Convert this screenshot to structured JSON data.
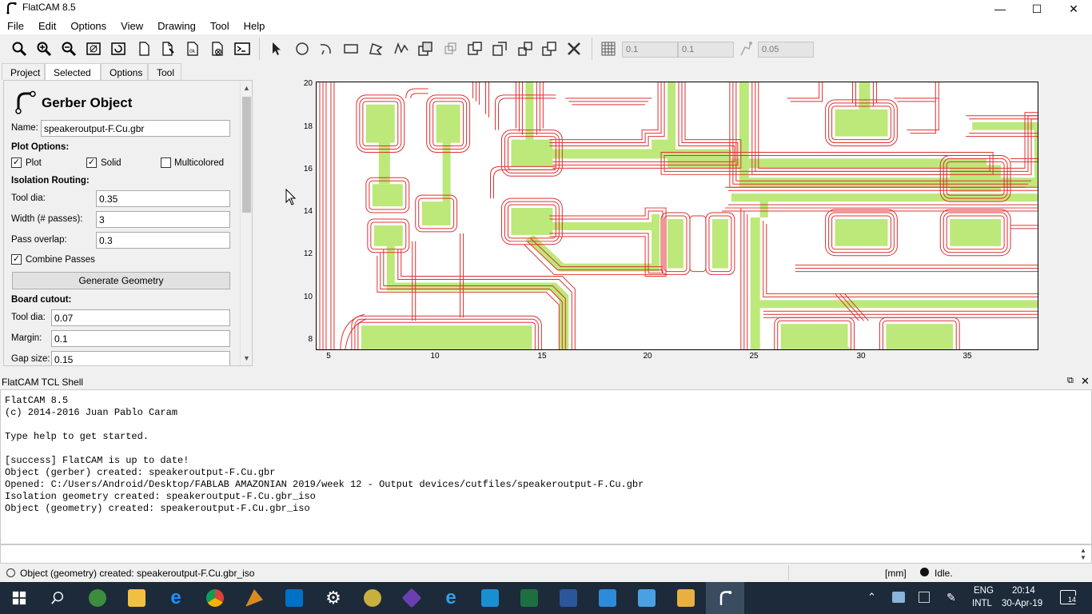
{
  "window": {
    "title": "FlatCAM 8.5",
    "minimize": "—",
    "maximize": "☐",
    "close": "✕"
  },
  "menu": [
    "File",
    "Edit",
    "Options",
    "View",
    "Drawing",
    "Tool",
    "Help"
  ],
  "toolbar": {
    "icons": [
      "zoom-fit-icon",
      "zoom-in-icon",
      "zoom-out-icon",
      "clear-plot-icon",
      "replot-icon",
      "new-blank-icon",
      "new-geometry-icon",
      "open-icon",
      "delete-icon",
      "shell-icon",
      "select-icon",
      "circle-icon",
      "arc-icon",
      "rectangle-icon",
      "polygon-icon",
      "path-icon",
      "union-icon",
      "intersection-icon",
      "subtraction-icon",
      "cut-icon",
      "copy-icon",
      "move-icon",
      "delete-shape-icon"
    ],
    "grid_x": "0.1",
    "grid_y": "0.1",
    "snap_max": "0.05"
  },
  "tabs": [
    "Project",
    "Selected",
    "Options",
    "Tool"
  ],
  "panel": {
    "heading": "Gerber Object",
    "name_label": "Name:",
    "name_value": "speakeroutput-F.Cu.gbr",
    "plot_options": "Plot Options:",
    "plot": "Plot",
    "solid": "Solid",
    "multicolored": "Multicolored",
    "isolation_routing": "Isolation Routing:",
    "tool_dia_label": "Tool dia:",
    "tool_dia_value": "0.35",
    "width_label": "Width (# passes):",
    "width_value": "3",
    "pass_overlap_label": "Pass overlap:",
    "pass_overlap_value": "0.3",
    "combine_passes": "Combine Passes",
    "generate_geometry": "Generate Geometry",
    "board_cutout": "Board cutout:",
    "cut_tool_dia_label": "Tool dia:",
    "cut_tool_dia_value": "0.07",
    "margin_label": "Margin:",
    "margin_value": "0.1",
    "gap_size_label": "Gap size:",
    "gap_size_value": "0.15",
    "checked": {
      "plot": true,
      "solid": true,
      "multicolored": false,
      "combine_passes": true
    }
  },
  "plot": {
    "y_ticks": [
      "20",
      "18",
      "16",
      "14",
      "12",
      "10",
      "8"
    ],
    "x_ticks": [
      "5",
      "10",
      "15",
      "20",
      "25",
      "30",
      "35"
    ],
    "copper_color": "#bde87a",
    "iso_color": "#e03030"
  },
  "shell": {
    "title": "FlatCAM TCL Shell",
    "lines": [
      "FlatCAM 8.5",
      "(c) 2014-2016 Juan Pablo Caram",
      "",
      "Type help to get started.",
      "",
      "[success] FlatCAM is up to date!",
      "Object (gerber) created: speakeroutput-F.Cu.gbr",
      "Opened: C:/Users/Android/Desktop/FABLAB AMAZONIAN 2019/week 12 - Output devices/cutfiles/speakeroutput-F.Cu.gbr",
      "Isolation geometry created: speakeroutput-F.Cu.gbr_iso",
      "Object (geometry) created: speakeroutput-F.Cu.gbr_iso"
    ]
  },
  "status": {
    "message": "Object (geometry) created: speakeroutput-F.Cu.gbr_iso",
    "units": "[mm]",
    "state": "Idle."
  },
  "taskbar": {
    "apps": [
      "globe-icon",
      "file-explorer-icon",
      "edge-icon",
      "chrome-icon",
      "bird-icon",
      "outlook-icon",
      "settings-icon",
      "earth-icon",
      "git-icon",
      "internet-explorer-icon",
      "terminal-icon",
      "excel-icon",
      "word-icon",
      "remote-icon",
      "photos-icon",
      "archive-icon",
      "flatcam-icon"
    ],
    "lang": "ENG",
    "layout": "INTL",
    "time": "20:14",
    "date": "30-Apr-19",
    "notifications": "14"
  }
}
